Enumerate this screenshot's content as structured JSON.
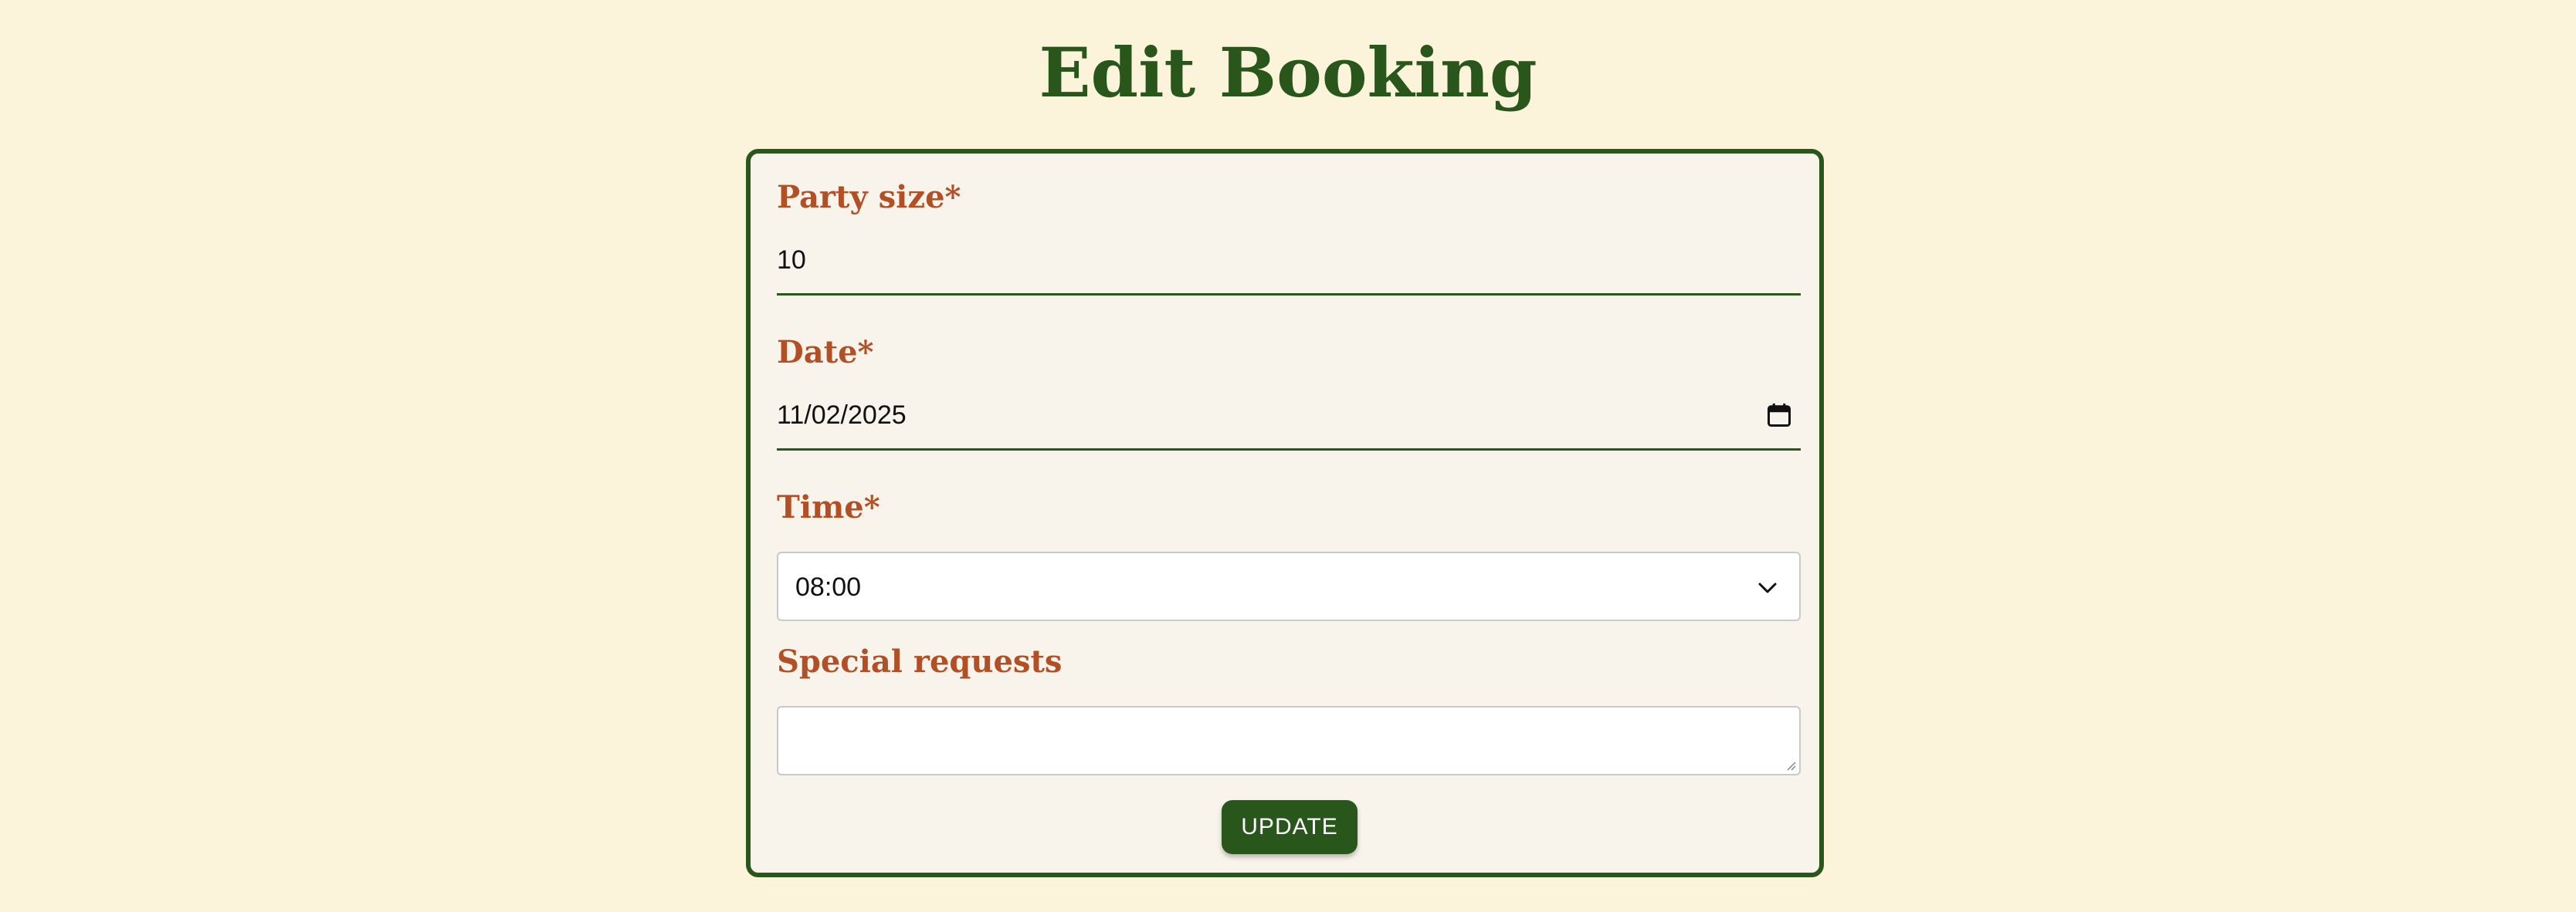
{
  "page": {
    "title": "Edit Booking"
  },
  "form": {
    "party_size": {
      "label": "Party size*",
      "value": "10"
    },
    "date": {
      "label": "Date*",
      "value": "11/02/2025",
      "icon": "calendar-icon"
    },
    "time": {
      "label": "Time*",
      "selected": "08:00",
      "icon": "chevron-down-icon"
    },
    "special_requests": {
      "label": "Special requests",
      "value": ""
    },
    "submit_label": "UPDATE"
  },
  "colors": {
    "background": "#fbf4da",
    "card_background": "#f8f4ec",
    "accent_green": "#29571b",
    "label_rust": "#b34f25"
  }
}
